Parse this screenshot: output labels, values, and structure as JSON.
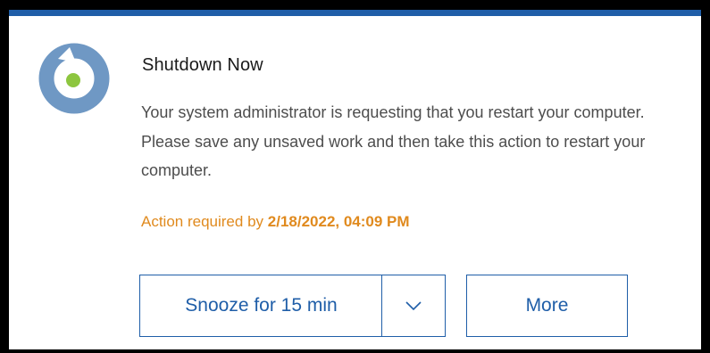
{
  "notification": {
    "title": "Shutdown Now",
    "message": "Your system administrator is requesting that you restart your computer. Please save any unsaved work and then take this action to restart your computer.",
    "deadline_prefix": "Action required by",
    "deadline_value": "2/18/2022, 04:09 PM"
  },
  "actions": {
    "snooze_label": "Snooze for 15 min",
    "more_label": "More"
  },
  "icons": {
    "logo": "app-logo-icon",
    "dropdown": "chevron-down-icon"
  },
  "colors": {
    "accent": "#1f5ea8",
    "logo_ring": "#6f98c4",
    "logo_dot": "#8dc63f",
    "deadline": "#e08a1e",
    "title_text": "#1a1a1a",
    "body_text": "#4d4d4d"
  }
}
